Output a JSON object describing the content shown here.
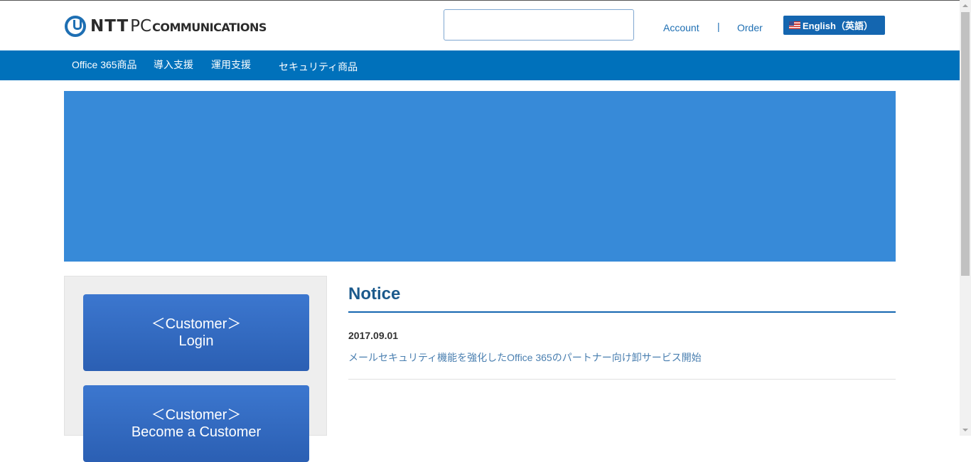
{
  "brand": {
    "logo_ntt": "NTT",
    "logo_pc": "PC",
    "logo_communications": "COMMUNICATIONS"
  },
  "header": {
    "search_value": "",
    "search_placeholder": "",
    "links": [
      "Account",
      "Order"
    ],
    "separator": "|",
    "language_button": "English（英語）"
  },
  "nav": {
    "items": [
      "Office 365商品",
      "導入支援",
      "運用支援",
      "セキュリティ商品"
    ]
  },
  "banner": {
    "color": "#378ad8"
  },
  "sidebar": {
    "login_button": {
      "line1": "＜Customer＞",
      "line2": "Login"
    },
    "become_button": {
      "line1": "＜Customer＞",
      "line2": "Become a Customer"
    }
  },
  "notice": {
    "title": "Notice",
    "items": [
      {
        "date": "2017.09.01",
        "text": "メールセキュリティ機能を強化したOffice 365のパートナー向け卸サービス開始"
      }
    ]
  },
  "colors": {
    "accent": "#0071bb",
    "link": "#1e6fb3",
    "heading": "#1c5a8c"
  }
}
